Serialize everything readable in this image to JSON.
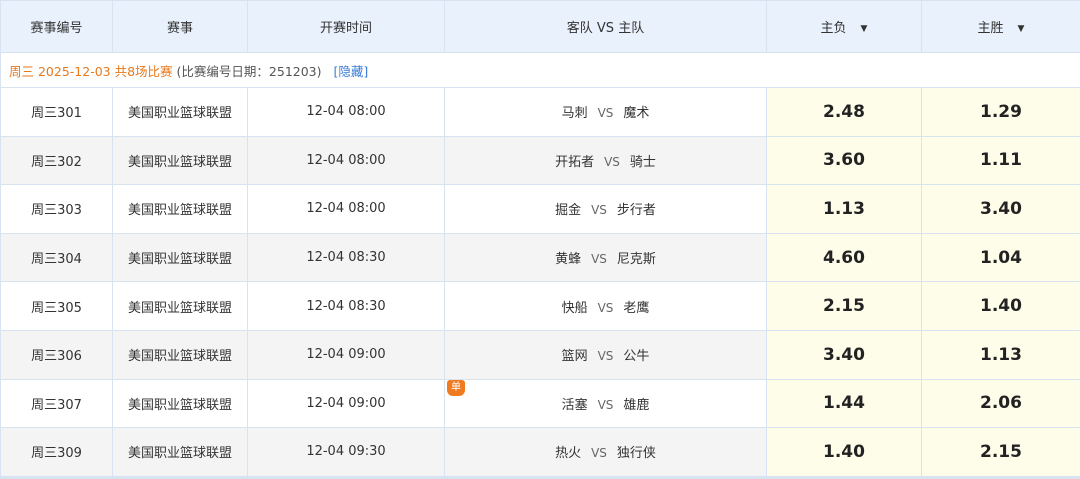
{
  "header": {
    "col_id": "赛事编号",
    "col_league": "赛事",
    "col_time": "开赛时间",
    "col_teams": "客队 VS 主队",
    "col_away_win": "主负",
    "col_home_win": "主胜",
    "sort_icon": "caret-down-icon"
  },
  "date_group": {
    "title": "周三 2025-12-03 共8场比赛",
    "subtitle": "(比赛编号日期：251203)",
    "hide_label": "[隐藏]"
  },
  "vs_label": "VS",
  "single_badge": "单",
  "games": [
    {
      "id": "周三301",
      "league": "美国职业篮球联盟",
      "time": "12-04 08:00",
      "away": "马刺",
      "home": "魔术",
      "lose": "2.48",
      "win": "1.29",
      "single": false
    },
    {
      "id": "周三302",
      "league": "美国职业篮球联盟",
      "time": "12-04 08:00",
      "away": "开拓者",
      "home": "骑士",
      "lose": "3.60",
      "win": "1.11",
      "single": false
    },
    {
      "id": "周三303",
      "league": "美国职业篮球联盟",
      "time": "12-04 08:00",
      "away": "掘金",
      "home": "步行者",
      "lose": "1.13",
      "win": "3.40",
      "single": false
    },
    {
      "id": "周三304",
      "league": "美国职业篮球联盟",
      "time": "12-04 08:30",
      "away": "黄蜂",
      "home": "尼克斯",
      "lose": "4.60",
      "win": "1.04",
      "single": false
    },
    {
      "id": "周三305",
      "league": "美国职业篮球联盟",
      "time": "12-04 08:30",
      "away": "快船",
      "home": "老鹰",
      "lose": "2.15",
      "win": "1.40",
      "single": false
    },
    {
      "id": "周三306",
      "league": "美国职业篮球联盟",
      "time": "12-04 09:00",
      "away": "篮网",
      "home": "公牛",
      "lose": "3.40",
      "win": "1.13",
      "single": false
    },
    {
      "id": "周三307",
      "league": "美国职业篮球联盟",
      "time": "12-04 09:00",
      "away": "活塞",
      "home": "雄鹿",
      "lose": "1.44",
      "win": "2.06",
      "single": true
    },
    {
      "id": "周三309",
      "league": "美国职业篮球联盟",
      "time": "12-04 09:30",
      "away": "热火",
      "home": "独行侠",
      "lose": "1.40",
      "win": "2.15",
      "single": false
    }
  ],
  "colors": {
    "header_bg": "#e9f2fc",
    "border": "#d7e3f1",
    "odds_bg": "#fefde9",
    "date_accent": "#e8791d",
    "link": "#3a7bd5",
    "badge": "#f07a1f"
  }
}
